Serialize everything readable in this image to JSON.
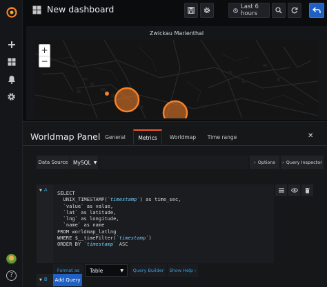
{
  "topnav": {
    "title": "New dashboard",
    "time_range": "Last 6 hours",
    "save_icon": "save-icon",
    "settings_icon": "gear-icon",
    "clock_icon": "clock-icon",
    "zoom_icon": "zoom-out-icon",
    "refresh_icon": "refresh-icon",
    "back_icon": "back-arrow-icon"
  },
  "sidebar": {
    "items": [
      "grafana-logo-icon",
      "plus-icon",
      "dashboards-icon",
      "bell-icon",
      "gear-icon"
    ],
    "help_label": "?"
  },
  "map_panel": {
    "title": "Zwickau Marienthal",
    "zoom_in": "+",
    "zoom_out": "−",
    "accent": "#f5822a"
  },
  "editor": {
    "panel_title": "Worldmap Panel",
    "tabs": [
      {
        "label": "General",
        "active": false
      },
      {
        "label": "Metrics",
        "active": true
      },
      {
        "label": "Worldmap",
        "active": false
      },
      {
        "label": "Time range",
        "active": false
      }
    ],
    "close_label": "✕",
    "datasource": {
      "label": "Data Source",
      "value": "MySQL",
      "options_label": "Options",
      "inspector_label": "Query Inspector"
    },
    "query": {
      "ref": "A",
      "code_lines": [
        "SELECT",
        "  UNIX_TIMESTAMP(`timestamp`) as time_sec,",
        "  `value` as value,",
        "  `lat` as latitude,",
        "  `lng` as longitude,",
        "  `name` as name",
        "FROM worldmap_latlng",
        "WHERE $__timeFilter(`timestamp`)",
        "ORDER BY `timestamp` ASC"
      ],
      "format_label": "Format as",
      "format_value": "Table",
      "query_builder": "Query Builder",
      "show_help": "Show Help"
    },
    "add_query": "Add Query",
    "brand_blue": "#1f60c4",
    "tab_accent": "#f05a28"
  }
}
